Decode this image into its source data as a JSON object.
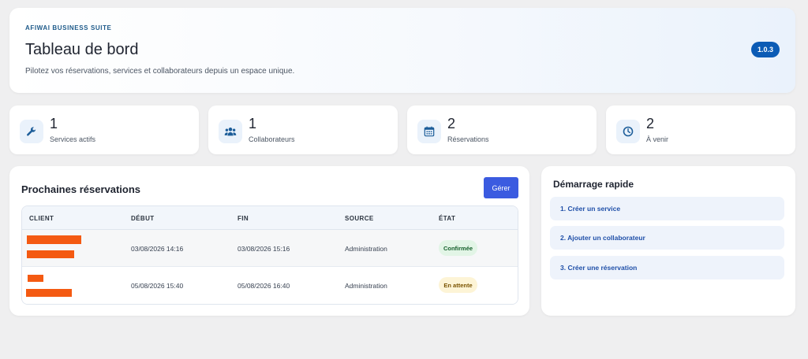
{
  "header": {
    "eyebrow": "AFIWAI BUSINESS SUITE",
    "title": "Tableau de bord",
    "subtitle": "Pilotez vos réservations, services et collaborateurs depuis un espace unique.",
    "version": "1.0.3"
  },
  "stats": [
    {
      "icon": "wrench-icon",
      "value": "1",
      "label": "Services actifs"
    },
    {
      "icon": "people-icon",
      "value": "1",
      "label": "Collaborateurs"
    },
    {
      "icon": "calendar-icon",
      "value": "2",
      "label": "Réservations"
    },
    {
      "icon": "clock-icon",
      "value": "2",
      "label": "À venir"
    }
  ],
  "reservations": {
    "title": "Prochaines réservations",
    "manage_label": "Gérer",
    "columns": [
      "CLIENT",
      "DÉBUT",
      "FIN",
      "SOURCE",
      "ÉTAT"
    ],
    "rows": [
      {
        "start": "03/08/2026 14:16",
        "end": "03/08/2026 15:16",
        "source": "Administration",
        "status": "Confirmée",
        "status_kind": "confirmed"
      },
      {
        "start": "05/08/2026 15:40",
        "end": "05/08/2026 16:40",
        "source": "Administration",
        "status": "En attente",
        "status_kind": "pending"
      }
    ]
  },
  "quick_start": {
    "title": "Démarrage rapide",
    "items": [
      "1. Créer un service",
      "2. Ajouter un collaborateur",
      "3. Créer une réservation"
    ]
  },
  "colors": {
    "accent": "#3b5be0",
    "version_badge": "#0b5bb5",
    "redaction": "#f45a12",
    "confirmed_bg": "#e2f5e6",
    "pending_bg": "#fdf4d6"
  }
}
